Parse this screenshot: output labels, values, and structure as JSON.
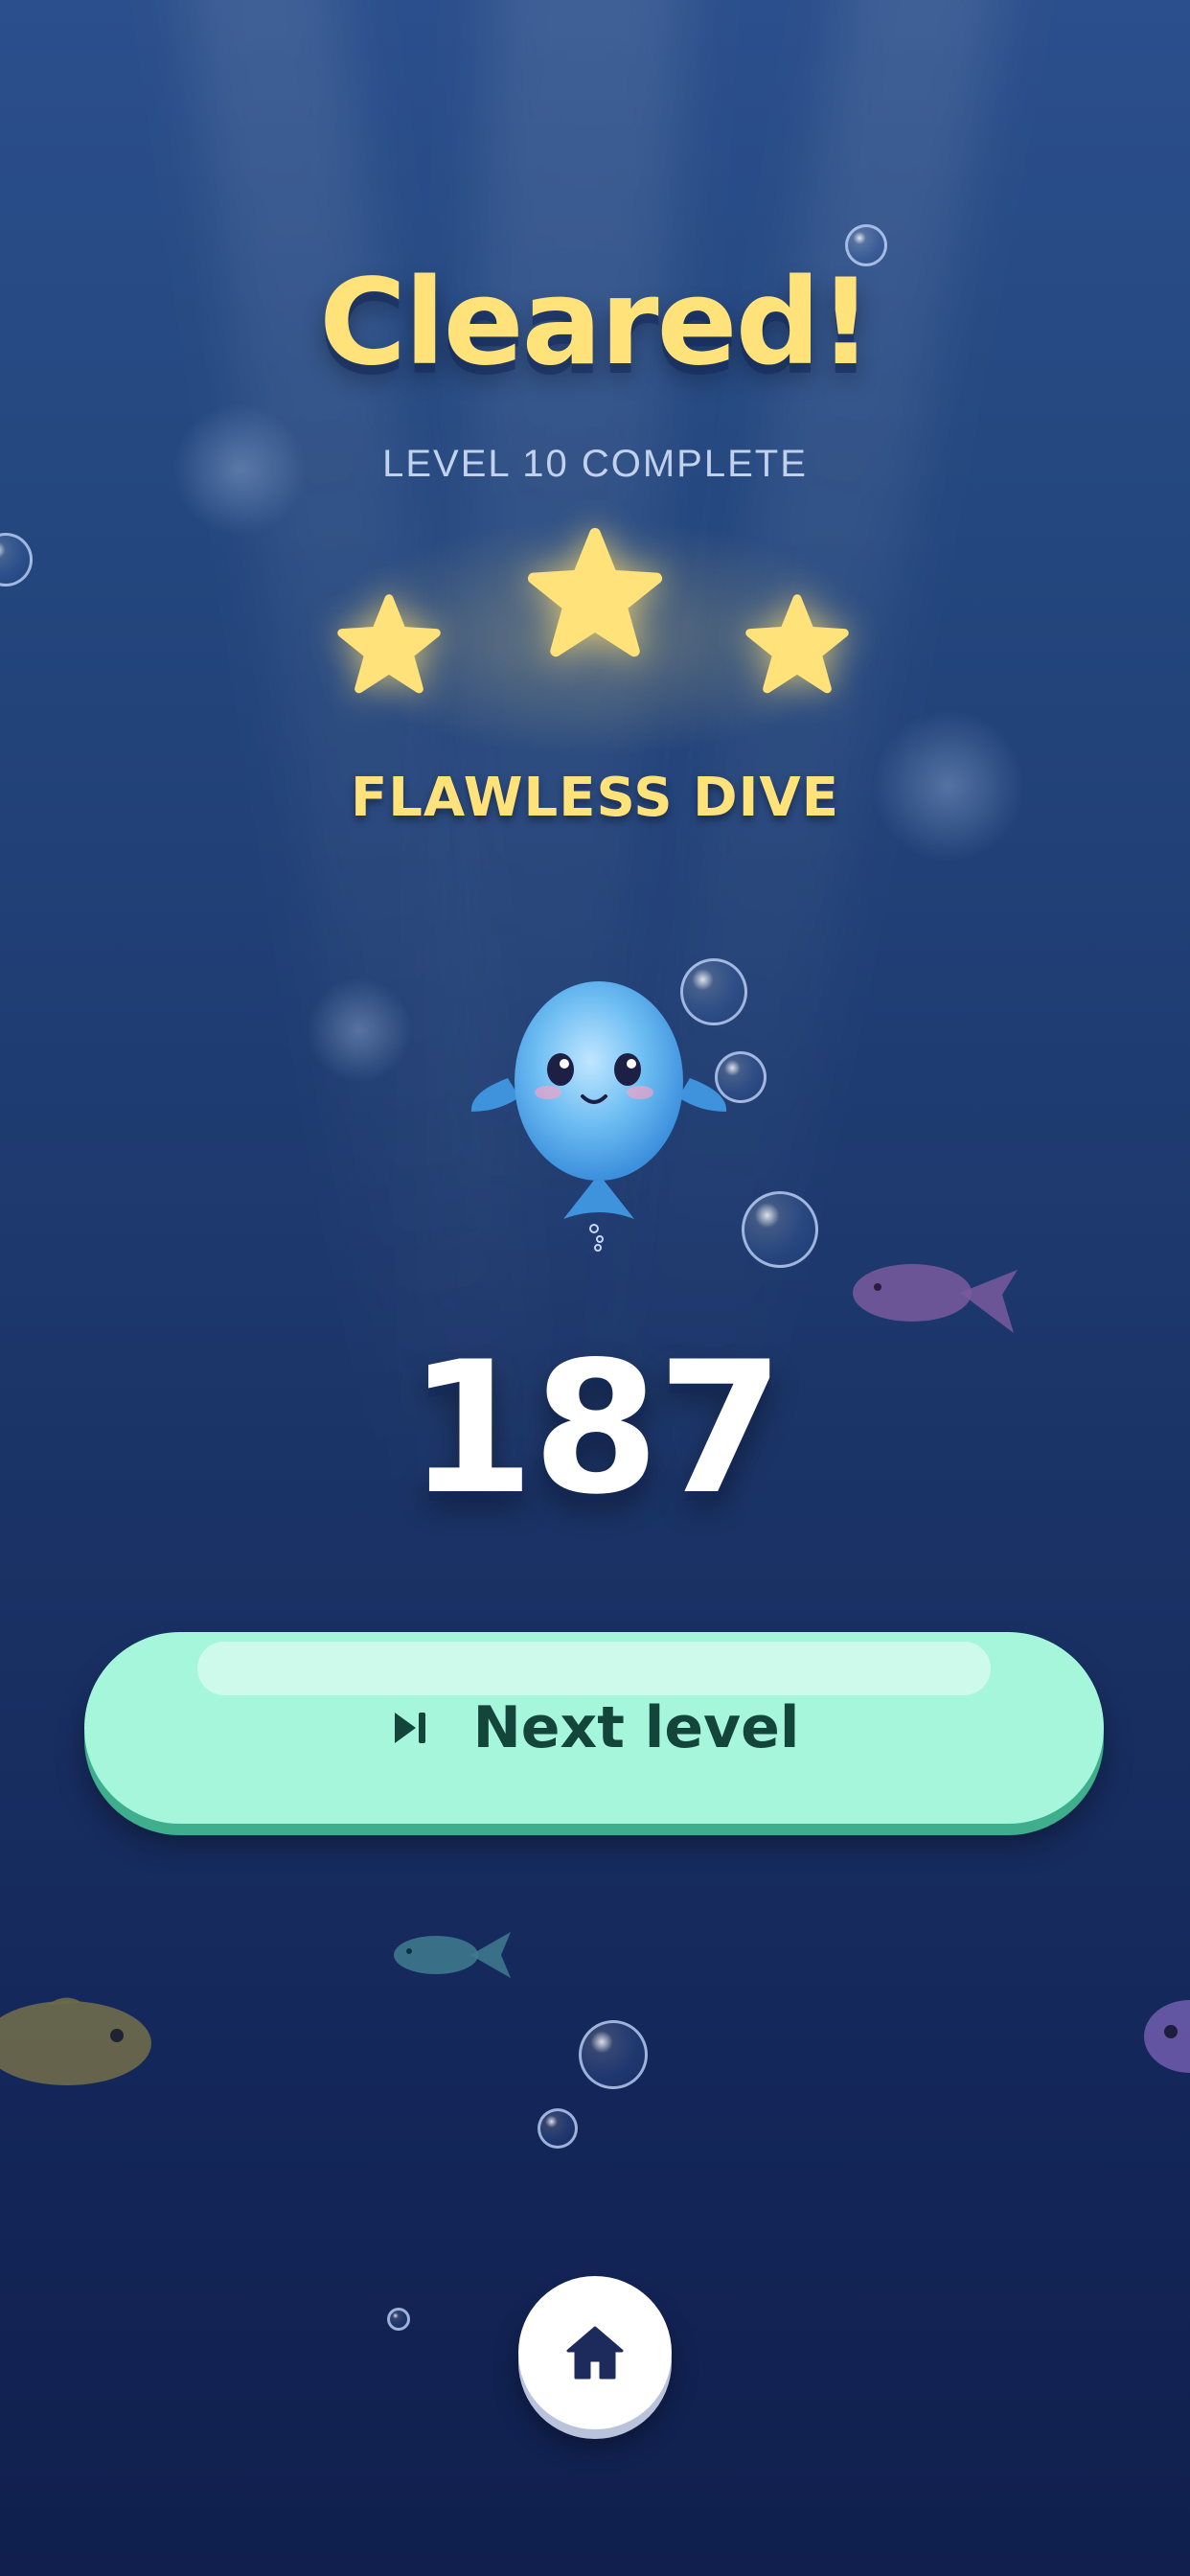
{
  "screen": {
    "title": "Cleared!",
    "subtitle": "LEVEL 10 COMPLETE",
    "stars_earned": 3,
    "stars_total": 3,
    "badge": "FLAWLESS DIVE",
    "score": "187"
  },
  "actions": {
    "next_label": "Next level",
    "next_icon": "skip-next-icon",
    "home_icon": "home-icon"
  },
  "colors": {
    "title": "#ffe27a",
    "star": "#ffe27a",
    "button": "#a6f6dc",
    "button_text": "#14453a",
    "home_icon": "#1d2a5c"
  }
}
